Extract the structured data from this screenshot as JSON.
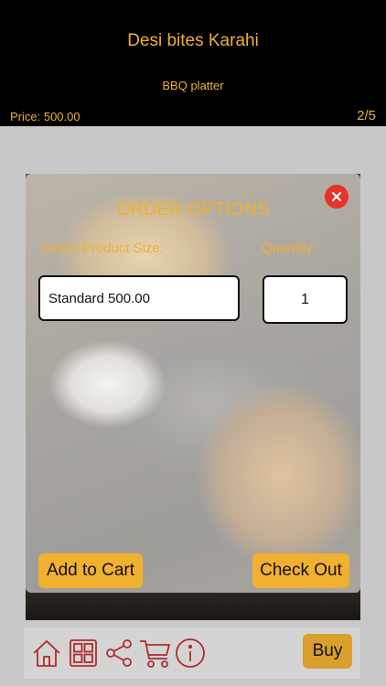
{
  "header": {
    "title": "Desi bites Karahi",
    "subtitle": "BBQ platter",
    "price": "Price: 500.00",
    "counter": "2/5"
  },
  "modal": {
    "title": "ORDER OPTIONS",
    "size_label": "Select Product Size:",
    "quantity_label": "Quantity:",
    "size_value": "Standard 500.00",
    "quantity_value": "1",
    "add_to_cart_label": "Add to Cart",
    "checkout_label": "Check Out"
  },
  "toolbar": {
    "icons": [
      "home-icon",
      "grid-icon",
      "share-icon",
      "cart-icon",
      "info-icon"
    ],
    "buy_label": "Buy"
  },
  "colors": {
    "accent": "#f0b030",
    "close": "#e8332a",
    "icon": "#b22b2b",
    "header_bg": "#000000"
  }
}
